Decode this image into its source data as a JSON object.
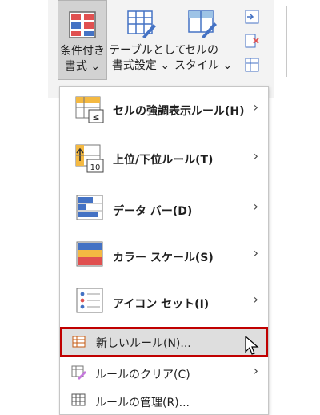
{
  "ribbon": {
    "conditional_format": {
      "line1": "条件付き",
      "line2": "書式 ⌄"
    },
    "format_as_table": {
      "line1": "テーブルとして",
      "line2": "書式設定 ⌄"
    },
    "cell_styles": {
      "line1": "セルの",
      "line2": "スタイル ⌄"
    }
  },
  "menu": {
    "items": [
      {
        "label": "セルの強調表示ルール(H)",
        "chevron": "›"
      },
      {
        "label": "上位/下位ルール(T)",
        "chevron": "›"
      },
      {
        "label": "データ バー(D)",
        "chevron": "›"
      },
      {
        "label": "カラー スケール(S)",
        "chevron": "›"
      },
      {
        "label": "アイコン セット(I)",
        "chevron": "›"
      },
      {
        "label": "新しいルール(N)...",
        "chevron": ""
      },
      {
        "label": "ルールのクリア(C)",
        "chevron": "›"
      },
      {
        "label": "ルールの管理(R)...",
        "chevron": ""
      }
    ],
    "icon_texts": {
      "less_than": "≤",
      "top_ten": "10"
    }
  },
  "colors": {
    "highlight_border": "#c00000",
    "icon_blue": "#4472c4",
    "icon_red": "#e05050",
    "icon_orange": "#f4b942"
  }
}
